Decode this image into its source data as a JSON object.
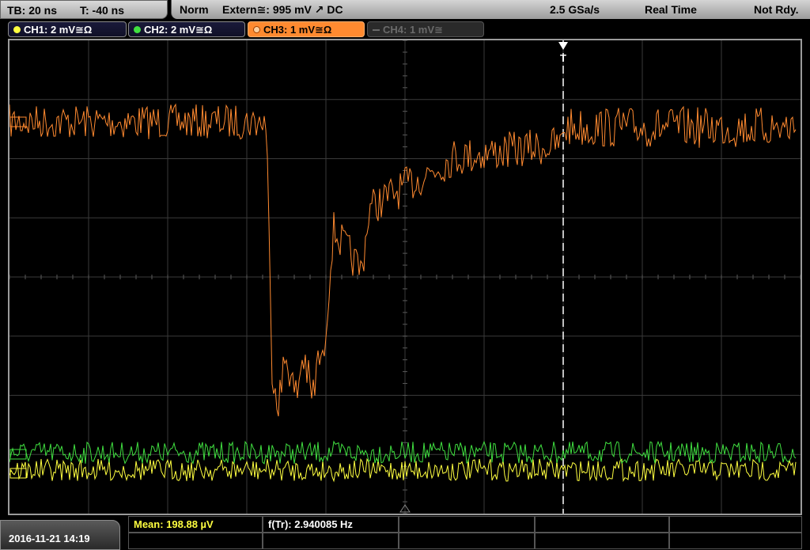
{
  "top": {
    "timebase": "TB: 20 ns",
    "trigger_time": "T: -40 ns",
    "mode": "Norm",
    "trigger_source": "Extern≅: 995 mV ↗ DC",
    "sample_rate": "2.5 GSa/s",
    "acq_mode": "Real Time",
    "state": "Not Rdy."
  },
  "channels": [
    {
      "label": "CH1: 2 mV≅Ω",
      "color": "#ffff40",
      "active": true
    },
    {
      "label": "CH2: 2 mV≅Ω",
      "color": "#40e040",
      "active": true
    },
    {
      "label": "CH3: 1 mV≅Ω",
      "color": "#ff8a30",
      "active": true,
      "selected": true
    },
    {
      "label": "CH4: 1 mV≅",
      "color": "#6a6a6a",
      "active": false
    }
  ],
  "trigger_marker": "T",
  "bottom": {
    "datetime": "2016-11-21 14:19",
    "measurements": [
      {
        "label": "Mean: 198.88 µV",
        "color": "#ffff40"
      },
      {
        "label": "f(Tr): 2.940085 Hz",
        "color": "#ffffff"
      }
    ]
  },
  "chart_data": {
    "type": "line",
    "grid": true,
    "x_divisions": 10,
    "y_divisions": 8,
    "series": [
      {
        "name": "CH3",
        "color": "#ff8a30"
      },
      {
        "name": "CH2",
        "color": "#40e040"
      },
      {
        "name": "CH1",
        "color": "#ffff40"
      }
    ]
  }
}
